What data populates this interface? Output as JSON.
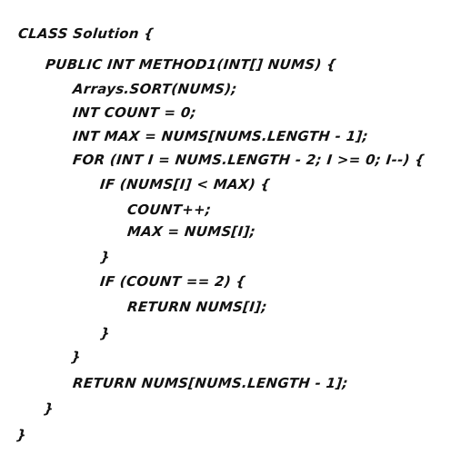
{
  "code": {
    "lines": [
      "CLASS Solution {",
      "PUBLIC INT METHOD1(INT[] NUMS) {",
      "Arrays.SORT(NUMS);",
      "INT COUNT = 0;",
      "INT MAX = NUMS[NUMS.LENGTH - 1];",
      "FOR (INT I = NUMS.LENGTH - 2; I >= 0; I--) {",
      "IF (NUMS[I] < MAX) {",
      "COUNT++;",
      "MAX = NUMS[I];",
      "}",
      "IF (COUNT == 2) {",
      "RETURN NUMS[I];",
      "}",
      "}",
      "RETURN NUMS[NUMS.LENGTH - 1];",
      "}",
      "}"
    ]
  }
}
